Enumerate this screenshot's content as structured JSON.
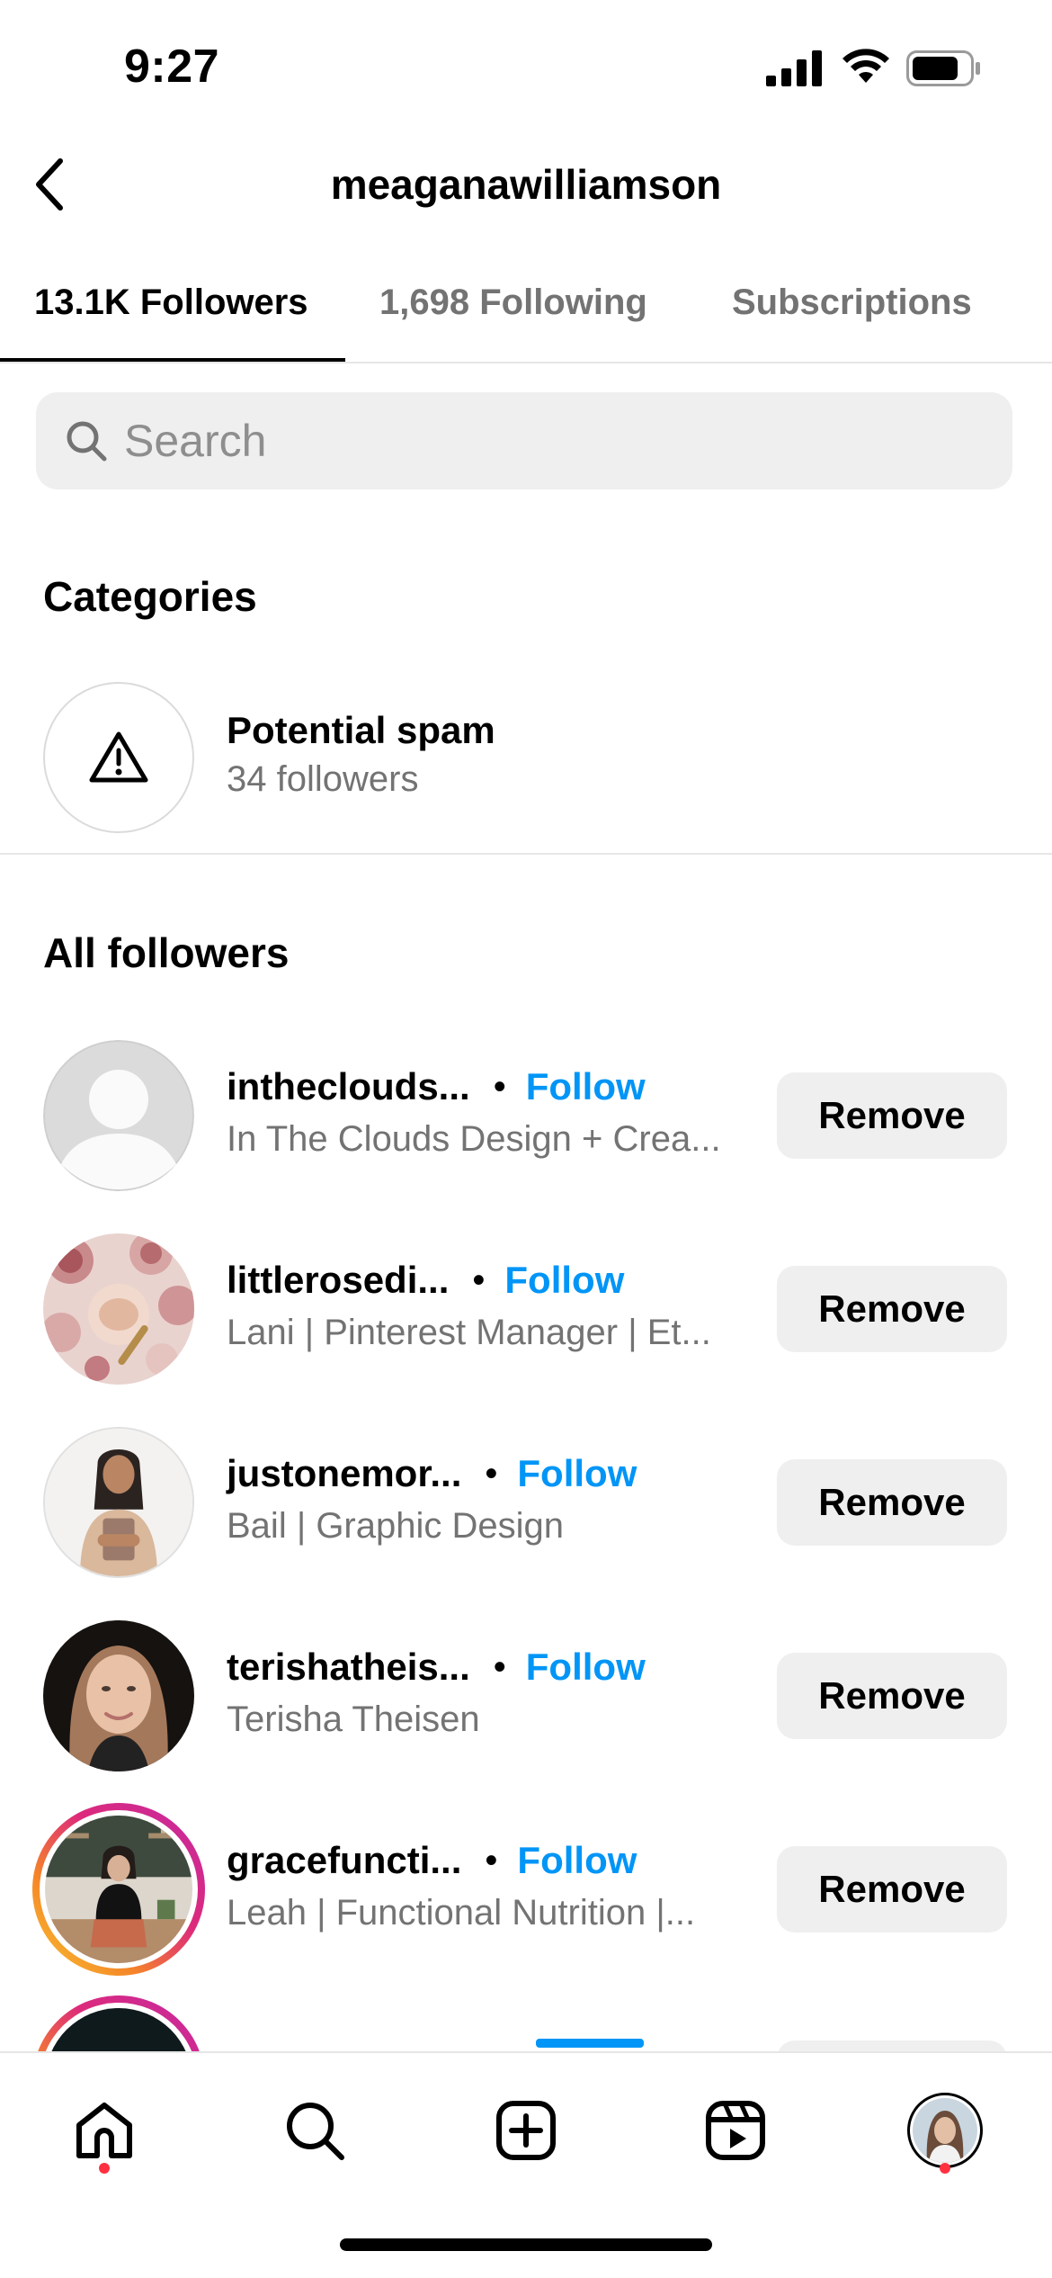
{
  "status_bar": {
    "time": "9:27"
  },
  "header": {
    "title": "meaganawilliamson"
  },
  "tabs": [
    {
      "label": "13.1K Followers",
      "active": true
    },
    {
      "label": "1,698 Following",
      "active": false
    },
    {
      "label": "Subscriptions",
      "active": false
    }
  ],
  "search": {
    "placeholder": "Search",
    "value": ""
  },
  "categories": {
    "title": "Categories",
    "items": [
      {
        "icon": "warning-icon",
        "title": "Potential spam",
        "subtitle": "34 followers"
      }
    ]
  },
  "followers": {
    "title": "All followers",
    "items": [
      {
        "username": "intheclouds...",
        "full_name": "In The Clouds Design + Crea...",
        "follow_label": "Follow",
        "remove_label": "Remove",
        "avatar": "default-avatar"
      },
      {
        "username": "littlerosedi...",
        "full_name": "Lani | Pinterest Manager | Et...",
        "follow_label": "Follow",
        "remove_label": "Remove",
        "avatar": "flowers-photo"
      },
      {
        "username": "justonemor...",
        "full_name": "Bail | Graphic Design",
        "follow_label": "Follow",
        "remove_label": "Remove",
        "avatar": "woman-photo"
      },
      {
        "username": "terishatheis...",
        "full_name": "Terisha Theisen",
        "follow_label": "Follow",
        "remove_label": "Remove",
        "avatar": "portrait-photo"
      },
      {
        "username": "gracefuncti...",
        "full_name": "Leah | Functional Nutrition |...",
        "follow_label": "Follow",
        "remove_label": "Remove",
        "avatar": "kitchen-photo",
        "has_story": true
      }
    ]
  },
  "colors": {
    "accent": "#0095f6",
    "secondary_text": "#737373",
    "button_bg": "#efefef",
    "notification_dot": "#ff3040"
  },
  "bottom_nav": {
    "items": [
      "home-icon",
      "search-icon",
      "create-icon",
      "reels-icon",
      "profile-avatar"
    ]
  }
}
